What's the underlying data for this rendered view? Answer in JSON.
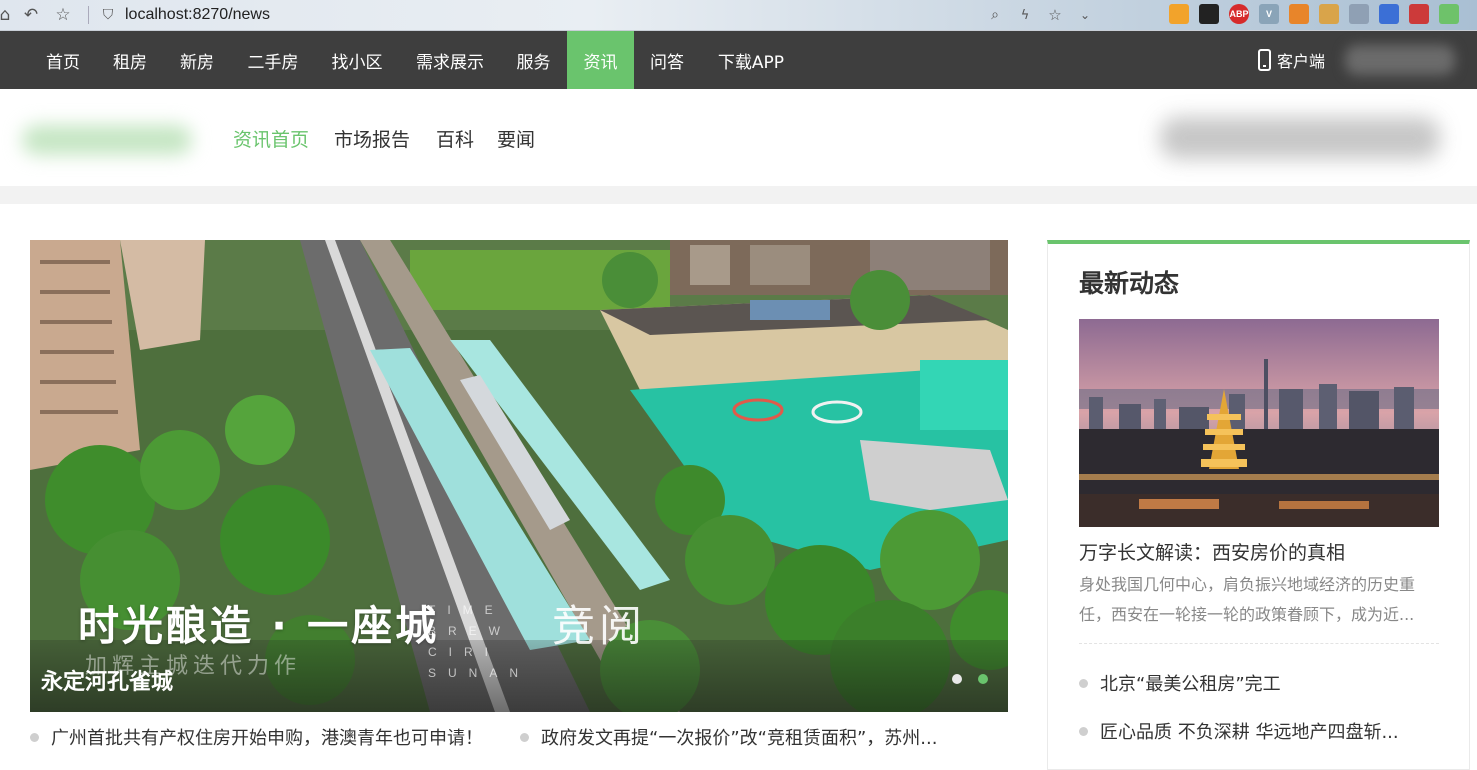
{
  "browser": {
    "url": "localhost:8270/news",
    "extensions": [
      {
        "name": "ms-icon",
        "label": "",
        "color": "#f2a32b"
      },
      {
        "name": "tampermonkey-icon",
        "label": "",
        "color": "#222222"
      },
      {
        "name": "adblock-icon",
        "label": "ABP",
        "color": "#d62b2b"
      },
      {
        "name": "vue-devtools-icon",
        "label": "V",
        "color": "#8aa4b8"
      },
      {
        "name": "notes-icon",
        "label": "",
        "color": "#e8852a"
      },
      {
        "name": "pocket-icon",
        "label": "",
        "color": "#d9a44a"
      },
      {
        "name": "screenshot-icon",
        "label": "",
        "color": "#8fa0b4"
      },
      {
        "name": "translate-icon",
        "label": "",
        "color": "#3b6fd6"
      },
      {
        "name": "paw-icon",
        "label": "",
        "color": "#cc3a3a"
      },
      {
        "name": "leaf-icon",
        "label": "",
        "color": "#6ec26a"
      }
    ]
  },
  "main_nav": {
    "items": [
      {
        "label": "首页"
      },
      {
        "label": "租房"
      },
      {
        "label": "新房"
      },
      {
        "label": "二手房"
      },
      {
        "label": "找小区"
      },
      {
        "label": "需求展示"
      },
      {
        "label": "服务"
      },
      {
        "label": "资讯",
        "active": true
      },
      {
        "label": "问答"
      },
      {
        "label": "下载APP"
      }
    ],
    "client_label": "客户端"
  },
  "sub_nav": {
    "items": [
      {
        "label": "资讯首页",
        "active": true
      },
      {
        "label": "市场报告"
      },
      {
        "label": "百科"
      },
      {
        "label": "要闻"
      }
    ]
  },
  "banner": {
    "overlay_title": "时光酿造 · 一座城",
    "overlay_subtitle": "加辉主城迭代力作",
    "overlay_english": "TIME BREW CIRI SUNAN",
    "overlay_logo": "竞阅",
    "caption": "永定河孔雀城",
    "slides": 2,
    "active_slide": 2
  },
  "headlines": [
    "广州首批共有产权住房开始申购，港澳青年也可申请！",
    "政府发文再提“一次报价”改“竞租赁面积”，苏州..."
  ],
  "latest": {
    "title": "最新动态",
    "feature_headline": "万字长文解读：西安房价的真相",
    "feature_desc": "身处我国几何中心，肩负振兴地域经济的历史重任，西安在一轮接一轮的政策眷顾下，成为近...",
    "items": [
      "北京“最美公租房”完工",
      "匠心品质 不负深耕 华远地产四盘斩..."
    ]
  },
  "colors": {
    "accent": "#6ac46d",
    "nav_bg": "#3e3e3e"
  }
}
